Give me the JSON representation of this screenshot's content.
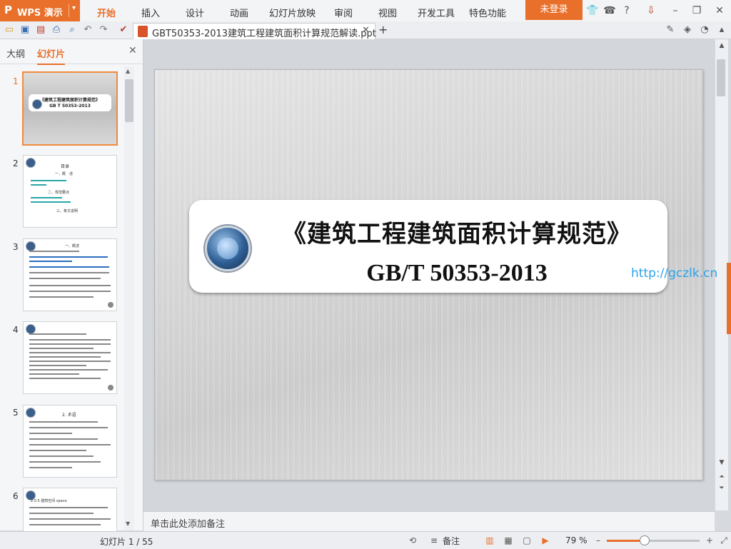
{
  "app": {
    "logo": "P",
    "name": "WPS 演示",
    "caret": "▾"
  },
  "menu": [
    "开始",
    "插入",
    "设计",
    "动画",
    "幻灯片放映",
    "审阅",
    "视图",
    "开发工具",
    "特色功能"
  ],
  "login_label": "未登录",
  "document_tab": {
    "title": "GBT50353-2013建筑工程建筑面积计算规范解读.ppt",
    "close": "✕"
  },
  "new_tab": "+",
  "left_pane": {
    "tab_outline": "大纲",
    "tab_slides": "幻灯片",
    "close": "✕",
    "slide_numbers": [
      "1",
      "2",
      "3",
      "4",
      "5",
      "6"
    ],
    "thumb1": {
      "title": "《建筑工程建筑面积计算规范》",
      "subtitle": "GB T 50353-2013"
    },
    "thumb2": {
      "heading": "目录",
      "section1": "一、概　述",
      "section2": "二、规范要点",
      "section3": "三、条文说明"
    },
    "thumb3": {
      "heading": "一、概述"
    },
    "thumb5": {
      "heading": "2. 术语"
    },
    "thumb6": {
      "line": "2.0.5 建筑空间 space"
    }
  },
  "slide": {
    "title": "《建筑工程建筑面积计算规范》",
    "subtitle": "GB/T 50353-2013",
    "watermark": "http://gczlk.cn"
  },
  "notes_placeholder": "单击此处添加备注",
  "status": {
    "slide_counter": "幻灯片 1 / 55",
    "notes_label": "备注",
    "zoom": "79 %",
    "zoom_level": 0.4
  },
  "colors": {
    "accent": "#e8702a",
    "watermark": "#2ba3ea"
  }
}
